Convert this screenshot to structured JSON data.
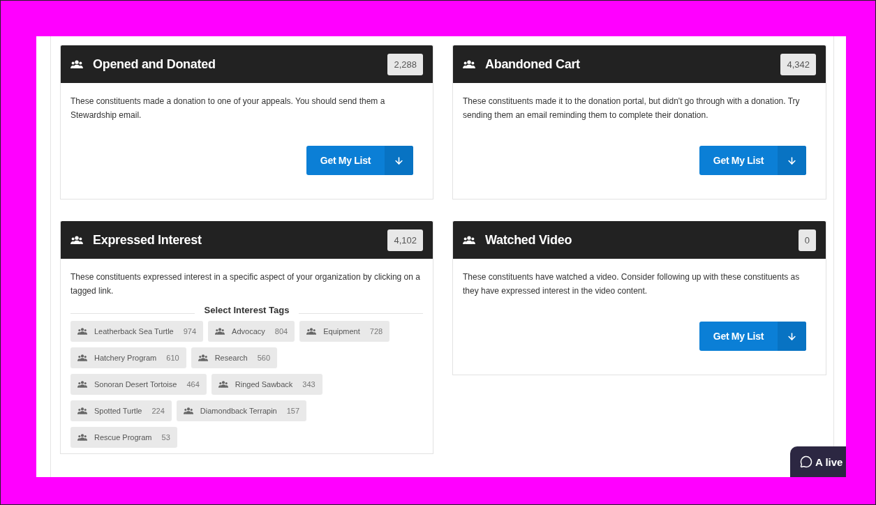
{
  "cards": [
    {
      "kind": "action",
      "title": "Opened and Donated",
      "count": "2,288",
      "description": "These constituents made a donation to one of your appeals. You should send them a Stewardship email.",
      "button": "Get My List"
    },
    {
      "kind": "action",
      "title": "Abandoned Cart",
      "count": "4,342",
      "description": "These constituents made it to the donation portal, but didn't go through with a donation. Try sending them an email reminding them to complete their donation.",
      "button": "Get My List"
    },
    {
      "kind": "tags",
      "title": "Expressed Interest",
      "count": "4,102",
      "description": "These constituents expressed interest in a specific aspect of your organization by clicking on a tagged link.",
      "tags_heading": "Select Interest Tags",
      "tags": [
        {
          "label": "Leatherback Sea Turtle",
          "count": "974"
        },
        {
          "label": "Advocacy",
          "count": "804"
        },
        {
          "label": "Equipment",
          "count": "728"
        },
        {
          "label": "Hatchery Program",
          "count": "610"
        },
        {
          "label": "Research",
          "count": "560"
        },
        {
          "label": "Sonoran Desert Tortoise",
          "count": "464"
        },
        {
          "label": "Ringed Sawback",
          "count": "343"
        },
        {
          "label": "Spotted Turtle",
          "count": "224"
        },
        {
          "label": "Diamondback Terrapin",
          "count": "157"
        },
        {
          "label": "Rescue Program",
          "count": "53"
        }
      ]
    },
    {
      "kind": "action",
      "title": "Watched Video",
      "count": "0",
      "description": "These constituents have watched a video. Consider following up with these constituents as they have expressed interest in the video content.",
      "button": "Get My List"
    }
  ],
  "chat": {
    "label": "A live"
  }
}
